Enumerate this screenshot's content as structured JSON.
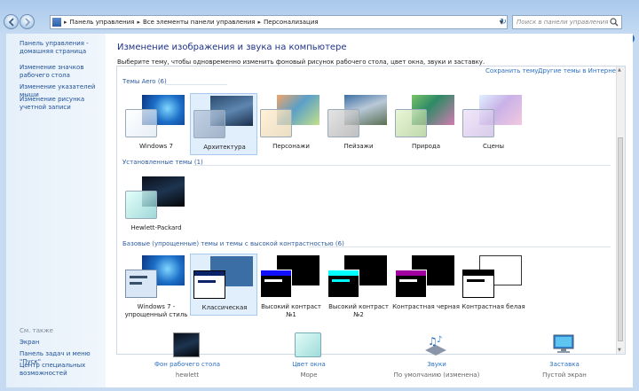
{
  "breadcrumb": [
    "Панель управления",
    "Все элементы панели управления",
    "Персонализация"
  ],
  "search_placeholder": "Поиск в панели управления",
  "help": "?",
  "sidebar": {
    "links": [
      "Панель управления - домашняя страница",
      "Изменение значков рабочего стола",
      "Изменение указателей мыши",
      "Изменение рисунка учетной записи"
    ],
    "see_also_title": "См. также",
    "see_also": [
      "Экран",
      "Панель задач и меню \"Пуск\"",
      "Центр специальных возможностей"
    ]
  },
  "main": {
    "title": "Изменение изображения и звука на компьютере",
    "description": "Выберите тему, чтобы одновременно изменить фоновый рисунок рабочего стола, цвет окна, звуки и заставку.",
    "save_theme": "Сохранить тему",
    "online_themes": "Другие темы в Интернете",
    "sections": {
      "aero": "Темы Aero (6)",
      "installed": "Установленные темы (1)",
      "basic": "Базовые (упрощенные) темы и темы с высокой контрастностью (6)"
    },
    "aero_themes": [
      "Windows 7",
      "Архитектура",
      "Персонажи",
      "Пейзажи",
      "Природа",
      "Сцены"
    ],
    "installed_themes": [
      "Hewlett-Packard"
    ],
    "basic_themes": [
      "Windows 7 - упрощенный стиль",
      "Классическая",
      "Высокий контраст №1",
      "Высокий контраст №2",
      "Контрастная черная",
      "Контрастная белая"
    ]
  },
  "bottom": [
    {
      "label": "Фон рабочего стола",
      "value": "hewlett"
    },
    {
      "label": "Цвет окна",
      "value": "Море"
    },
    {
      "label": "Звуки",
      "value": "По умолчанию (изменена)"
    },
    {
      "label": "Заставка",
      "value": "Пустой экран"
    }
  ]
}
